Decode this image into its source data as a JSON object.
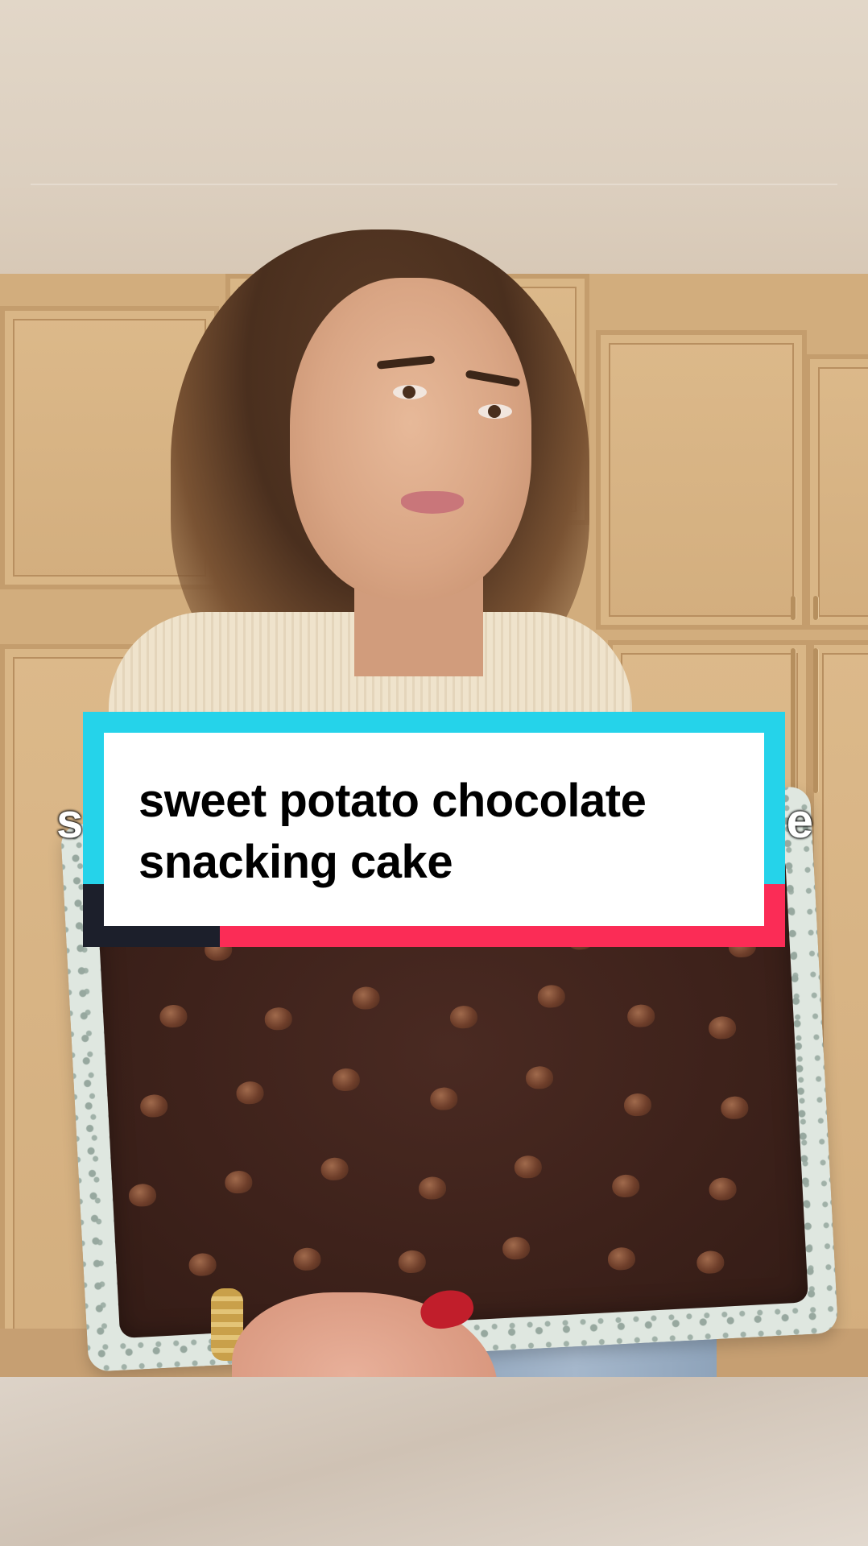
{
  "caption": {
    "line1": "sweet potato chocolate",
    "line2": "snacking cake",
    "ghost_left": "s",
    "ghost_right": "e"
  },
  "colors": {
    "caption_cyan": "#25d3ea",
    "caption_red": "#fb2c56",
    "caption_dark": "#1c1f2b",
    "caption_bg": "#ffffff",
    "nail_polish": "#c11e2b"
  },
  "scene": {
    "subject": "woman holding speckled baking pan with chocolate chip snacking cake",
    "icons": [
      "chocolate-chip-icon"
    ]
  }
}
